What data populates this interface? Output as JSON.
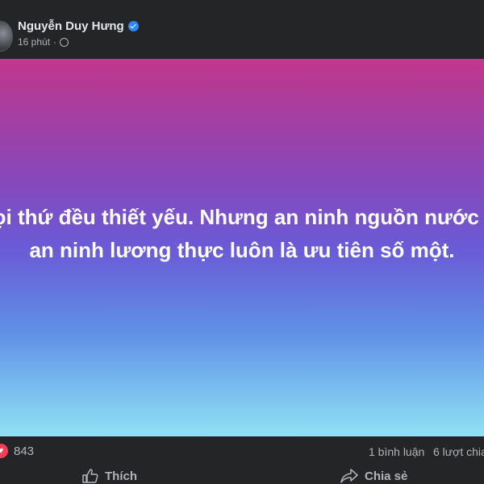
{
  "post": {
    "author": "Nguyễn Duy Hưng",
    "time": "16 phút",
    "separator": "·",
    "text": "Mọi thứ đều thiết yếu. Nhưng an ninh nguồn nước và an ninh lương thực luôn là ưu tiên số một.",
    "background_top": "#c1378c",
    "background_bottom": "#8fe2f6"
  },
  "stats": {
    "reactions": "843",
    "comments": "1 bình luận",
    "shares": "6 lượt chia"
  },
  "actions": {
    "like": "Thích",
    "share": "Chia sẻ"
  },
  "icons": {
    "verified": "verified-badge-icon",
    "audience": "globe-icon",
    "reaction": "heart-icon",
    "like": "thumbs-up-icon",
    "share": "share-arrow-icon"
  }
}
